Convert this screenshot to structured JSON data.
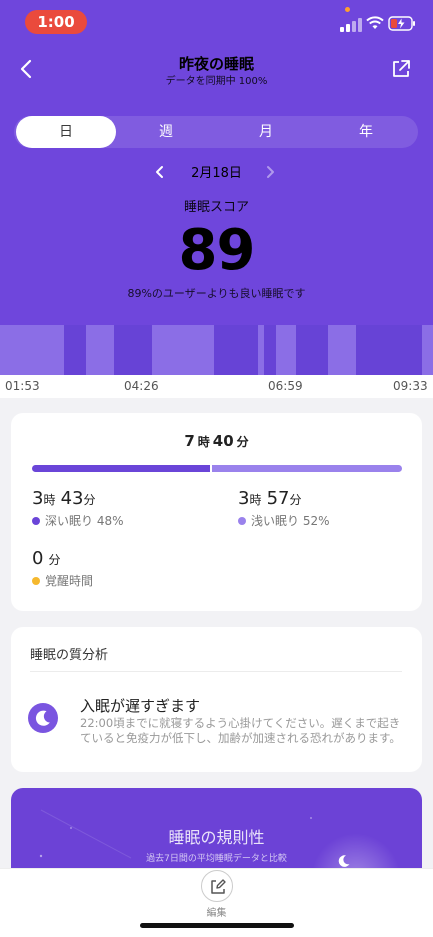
{
  "status_bar": {
    "time": "1:00"
  },
  "header": {
    "title": "昨夜の睡眠",
    "subtitle": "データを同期中 100%"
  },
  "tabs": [
    {
      "label": "日",
      "active": true
    },
    {
      "label": "週",
      "active": false
    },
    {
      "label": "月",
      "active": false
    },
    {
      "label": "年",
      "active": false
    }
  ],
  "date": "2月18日",
  "score": {
    "label": "睡眠スコア",
    "value": "89",
    "description": "89%のユーザーよりも良い睡眠です"
  },
  "timeline": {
    "labels": [
      "01:53",
      "04:26",
      "06:59",
      "09:33"
    ]
  },
  "summary": {
    "total_hours": "7",
    "hour_unit": "時",
    "total_minutes": "40",
    "minute_unit": "分",
    "deep": {
      "hours": "3",
      "minutes": "43",
      "legend": "深い眠り 48%"
    },
    "light": {
      "hours": "3",
      "minutes": "57",
      "legend": "浅い眠り 52%"
    },
    "awake": {
      "minutes": "0",
      "legend": "覚醒時間"
    }
  },
  "quality": {
    "title": "睡眠の質分析",
    "heading": "入眠が遅すぎます",
    "text": "22:00頃までに就寝するよう心掛けてください。遅くまで起きていると免疫力が低下し、加齢が加速される恐れがあります。"
  },
  "regularity": {
    "title": "睡眠の規則性",
    "subtitle": "過去7日間の平均睡眠データと比較"
  },
  "bottom": {
    "edit_label": "編集"
  },
  "colors": {
    "primary": "#6f46dc",
    "deep": "#6a45d8",
    "light": "#9a82ec",
    "awake": "#f5b82e",
    "status_pill": "#ea4a3c"
  }
}
